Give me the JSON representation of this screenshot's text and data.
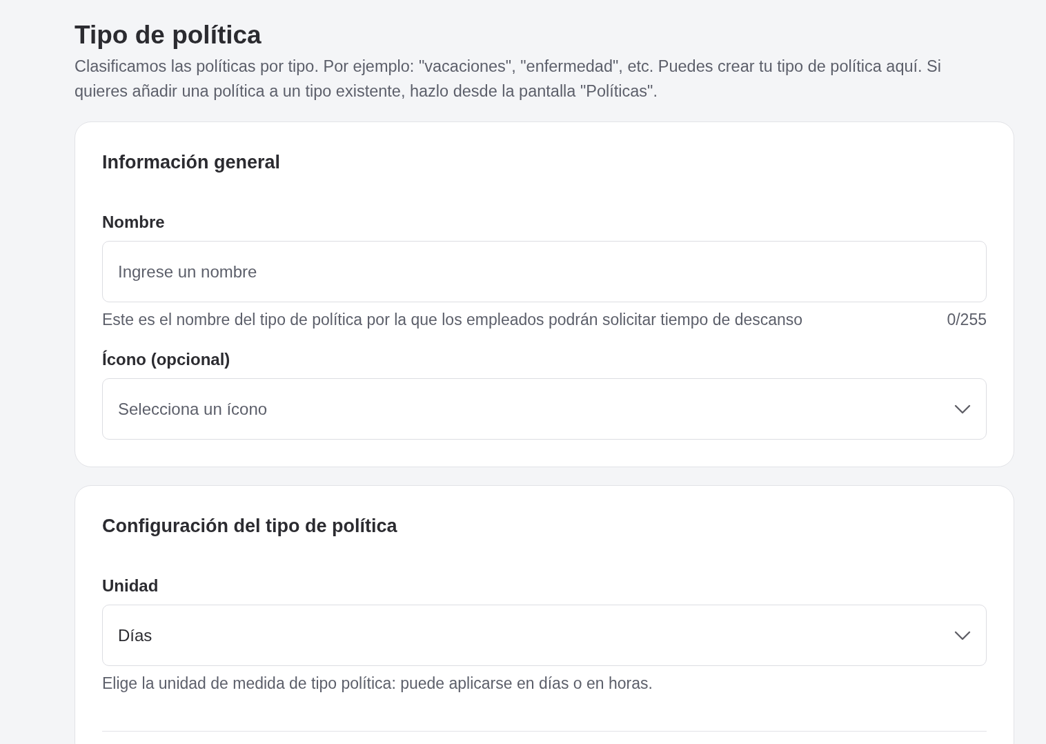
{
  "page": {
    "title": "Tipo de política",
    "description": "Clasificamos las políticas por tipo. Por ejemplo: \"vacaciones\", \"enfermedad\", etc. Puedes crear tu tipo de política aquí. Si quieres añadir una política a un tipo existente, hazlo desde la pantalla \"Políticas\"."
  },
  "cards": [
    {
      "heading": "Información general",
      "fields": [
        {
          "kind": "text",
          "label": "Nombre",
          "placeholder": "Ingrese un nombre",
          "hint": "Este es el nombre del tipo de política por la que los empleados podrán solicitar tiempo de descanso",
          "counter": "0/255"
        },
        {
          "kind": "select",
          "label": "Ícono (opcional)",
          "placeholder": "Selecciona un ícono"
        }
      ]
    },
    {
      "heading": "Configuración del tipo de política",
      "fields": [
        {
          "kind": "select",
          "label": "Unidad",
          "value": "Días",
          "hint": "Elige la unidad de medida de tipo política: puede aplicarse en días o en horas."
        }
      ],
      "divider": true
    }
  ]
}
